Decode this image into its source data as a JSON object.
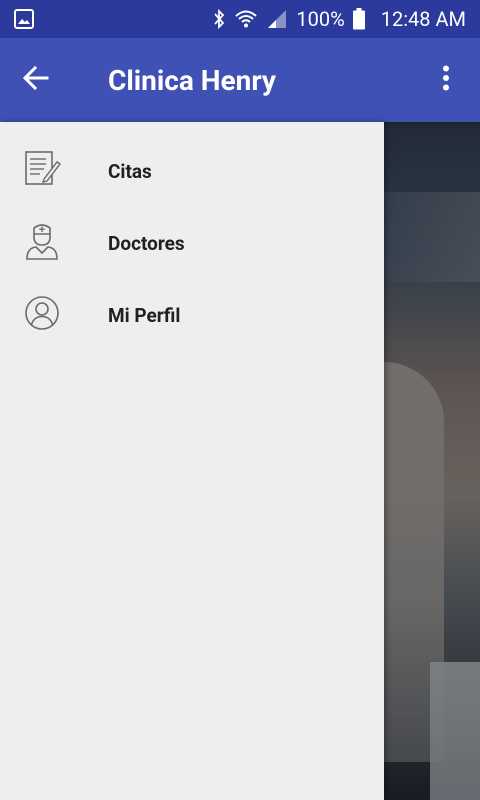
{
  "status_bar": {
    "battery": "100%",
    "time": "12:48 AM",
    "icons": [
      "image-notification-icon",
      "bluetooth-icon",
      "wifi-icon",
      "cell-signal-icon",
      "battery-icon"
    ]
  },
  "app_bar": {
    "title": "Clinica Henry",
    "color": "#3f51b5",
    "back_icon": "arrow-back-icon",
    "menu_icon": "more-vert-icon"
  },
  "drawer": {
    "items": [
      {
        "label": "Citas",
        "icon": "appointment-list-icon"
      },
      {
        "label": "Doctores",
        "icon": "doctor-icon"
      },
      {
        "label": "Mi Perfil",
        "icon": "profile-icon"
      }
    ]
  }
}
